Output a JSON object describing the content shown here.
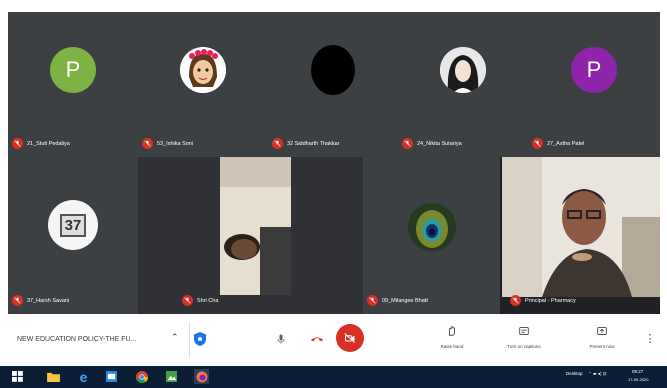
{
  "participants": [
    {
      "name": "21_Stuti Pedaliya",
      "avatar_letter": "P",
      "avatar_color": "#7cb342"
    },
    {
      "name": "53_Ishika Soni",
      "avatar_type": "cartoon-girl"
    },
    {
      "name": "32 Siddharth Thakkar",
      "avatar_type": "dark-circle"
    },
    {
      "name": "24_Nikita Sutariya",
      "avatar_type": "photo"
    },
    {
      "name": "27_Astha Patel",
      "avatar_letter": "P",
      "avatar_color": "#8e24aa"
    },
    {
      "name": "37_Harsh Savani",
      "avatar_text": "37"
    },
    {
      "name": "Shri Cha",
      "avatar_type": "video"
    },
    {
      "name": "09_Milangee Bhatt",
      "avatar_type": "peacock-feather"
    },
    {
      "name": "Principal - Pharmacy",
      "avatar_type": "video"
    }
  ],
  "meeting": {
    "title": "NEW EDUCATION POLICY-THE FU...",
    "raise_hand": "Raise hand",
    "captions": "Turn on captions",
    "present": "Present now"
  },
  "taskbar": {
    "desktop_label": "Desktop",
    "time": "09:27",
    "date": "17-09-2020"
  },
  "colors": {
    "meet_bg": "#202124",
    "muted_red": "#d93025",
    "taskbar_bg": "#0c1e36"
  }
}
